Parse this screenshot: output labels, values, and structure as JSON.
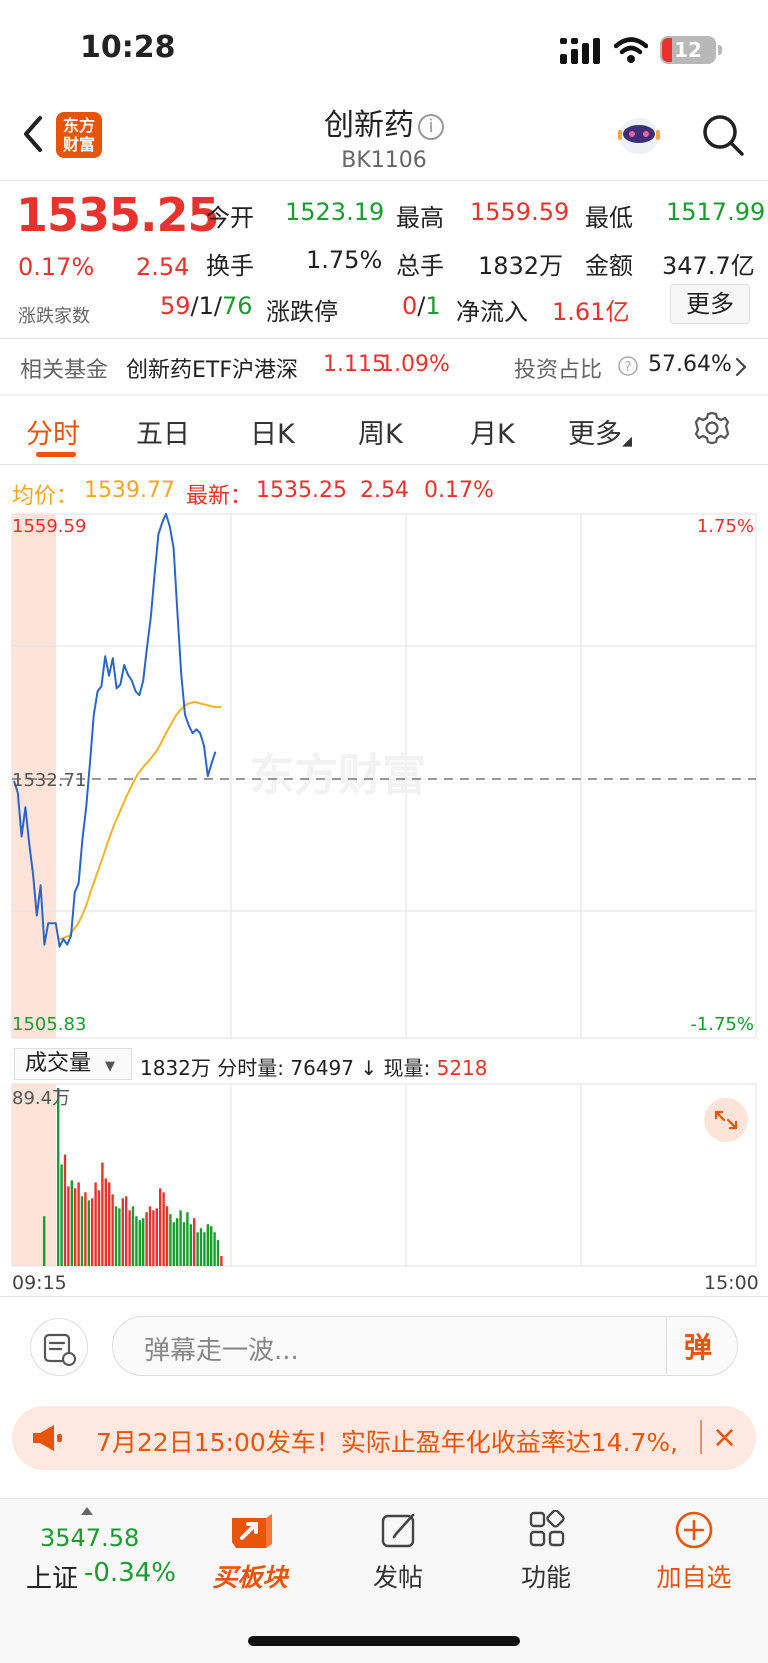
{
  "status": {
    "time": "10:28",
    "battery": "12"
  },
  "header": {
    "logo_line1": "东方",
    "logo_line2": "财富",
    "title": "创新药",
    "info": "i",
    "code": "BK1106"
  },
  "quote": {
    "price": "1535.25",
    "pct": "0.17%",
    "change": "2.54",
    "open_label": "今开",
    "open": "1523.19",
    "high_label": "最高",
    "high": "1559.59",
    "low_label": "最低",
    "low": "1517.99",
    "turnover_label": "换手",
    "turnover": "1.75%",
    "volume_label": "总手",
    "volume": "1832万",
    "amount_label": "金额",
    "amount": "347.7亿",
    "updown_label": "涨跌家数",
    "up_count": "59",
    "flat_count": "1",
    "down_count": "76",
    "slash": "/",
    "limit_label": "涨跌停",
    "limit_up": "0",
    "limit_down": "1",
    "netflow_label": "净流入",
    "netflow": "1.61亿",
    "more": "更多"
  },
  "fund": {
    "label": "相关基金",
    "name": "创新药ETF沪港深",
    "price": "1.115",
    "pct": "1.09%",
    "ratio_label": "投资占比",
    "ratio": "57.64%"
  },
  "tabs": [
    "分时",
    "五日",
    "日K",
    "周K",
    "月K",
    "更多"
  ],
  "chart": {
    "avg_label": "均价：",
    "avg": "1539.77",
    "latest_label": "最新：",
    "latest": "1535.25",
    "latest_change": "2.54",
    "latest_pct": "0.17%",
    "top_price": "1559.59",
    "mid_price": "1532.71",
    "bottom_price": "1505.83",
    "top_pct": "1.75%",
    "bottom_pct": "-1.75%",
    "watermark": "东方财富",
    "volume_select": "成交量",
    "vol_total": "1832万",
    "vol_period_label": "分时量:",
    "vol_period": "76497",
    "arrow": "↓",
    "vol_now_label": "现量:",
    "vol_now": "5218",
    "vol_max": "89.4万",
    "time_start": "09:15",
    "time_end": "15:00"
  },
  "chart_data": {
    "type": "line",
    "ylim": [
      1505.83,
      1559.59
    ],
    "baseline": 1532.71,
    "series": [
      {
        "name": "最新",
        "color": "#2a66c8",
        "values": [
          1532.2,
          1531.0,
          1526.5,
          1529.5,
          1525.8,
          1522.7,
          1518.4,
          1521.5,
          1515.4,
          1517.6,
          1517.6,
          1517.6,
          1515.2,
          1516.0,
          1515.4,
          1516.3,
          1520.8,
          1521.7,
          1526.2,
          1529.5,
          1534.1,
          1539.0,
          1541.4,
          1541.9,
          1545.0,
          1543.0,
          1544.8,
          1541.7,
          1542.1,
          1544.1,
          1543.1,
          1542.5,
          1541.4,
          1541.0,
          1542.5,
          1545.9,
          1549.0,
          1553.4,
          1557.5,
          1558.7,
          1559.6,
          1558.3,
          1556.1,
          1549.5,
          1543.2,
          1539.0,
          1537.9,
          1537.1,
          1537.5,
          1537.1,
          1535.8,
          1532.7,
          1534.0,
          1535.2
        ]
      },
      {
        "name": "均价",
        "color": "#f5b323",
        "values": [
          1516.0,
          1516.0,
          1516.2,
          1516.3,
          1516.9,
          1517.4,
          1518.1,
          1519.0,
          1520.1,
          1521.3,
          1522.4,
          1523.5,
          1524.6,
          1525.8,
          1526.9,
          1527.9,
          1528.8,
          1529.7,
          1530.6,
          1531.4,
          1532.2,
          1532.9,
          1533.4,
          1533.9,
          1534.3,
          1534.8,
          1535.3,
          1536.0,
          1536.8,
          1537.5,
          1538.2,
          1538.9,
          1539.4,
          1539.8,
          1540.1,
          1540.2,
          1540.3,
          1540.2,
          1540.1,
          1540.0,
          1539.9,
          1539.8,
          1539.8,
          1539.77
        ]
      }
    ],
    "volume": [
      80000,
      0,
      0,
      0,
      0,
      0,
      0,
      0,
      0,
      0,
      0,
      0,
      0,
      0,
      0,
      0,
      0,
      0,
      0,
      0,
      0,
      0,
      0,
      0,
      0,
      0,
      0,
      0,
      0,
      0,
      0,
      0,
      0,
      0,
      0,
      0,
      0,
      0,
      0,
      0,
      0,
      0,
      0,
      0,
      0,
      0,
      0,
      0,
      0,
      0,
      0,
      0,
      0,
      0,
      0,
      0,
      0,
      0,
      0,
      0,
      0,
      0,
      0,
      0,
      0,
      0,
      0,
      0,
      0,
      0,
      0,
      0,
      0,
      0,
      0,
      0,
      0,
      0,
      0,
      0,
      0,
      0,
      0,
      0,
      0,
      0,
      0,
      0,
      0,
      0,
      0,
      0,
      0,
      0,
      0,
      0,
      0,
      0,
      0,
      0,
      0,
      0,
      0,
      0,
      0,
      0,
      0,
      0,
      0,
      0,
      0,
      0,
      0,
      0,
      0,
      0,
      0,
      0,
      0,
      0,
      0,
      0,
      0,
      0,
      0,
      0,
      0,
      0,
      0,
      0,
      0,
      0,
      0,
      0,
      0,
      0,
      0,
      0,
      0,
      0,
      0,
      0,
      0,
      0,
      0,
      0,
      0,
      0,
      0,
      0,
      0,
      0,
      0,
      0,
      0,
      0,
      0,
      0,
      0,
      0,
      0,
      0,
      0,
      0,
      0,
      0,
      0,
      0,
      0,
      0,
      0,
      0,
      0,
      0,
      0,
      0,
      0,
      0,
      0,
      0,
      0,
      0,
      0,
      0,
      0,
      0,
      0,
      0,
      0,
      0,
      0,
      0,
      0,
      0,
      0,
      0,
      0,
      0,
      0,
      0,
      0,
      0,
      0,
      0,
      0,
      0,
      0,
      0,
      0,
      0,
      0,
      0,
      0,
      0,
      0,
      0,
      0,
      0,
      0,
      0,
      0,
      0,
      0,
      0,
      0,
      0,
      0,
      0,
      0,
      0,
      0,
      0,
      0,
      0,
      0,
      0,
      0,
      0,
      0,
      0,
      0,
      0,
      0,
      0,
      0,
      0,
      0,
      0,
      0,
      0,
      0,
      0,
      0,
      0,
      0,
      0,
      0,
      0,
      0,
      0,
      0,
      0,
      0,
      0,
      0,
      0,
      0,
      0,
      0,
      0,
      0,
      0,
      0,
      0
    ],
    "vol_bars": [
      {
        "v": 894000,
        "c": "g"
      },
      {
        "v": 510000,
        "c": "g"
      },
      {
        "v": 560000,
        "c": "r"
      },
      {
        "v": 400000,
        "c": "r"
      },
      {
        "v": 430000,
        "c": "g"
      },
      {
        "v": 390000,
        "c": "r"
      },
      {
        "v": 420000,
        "c": "r"
      },
      {
        "v": 350000,
        "c": "g"
      },
      {
        "v": 370000,
        "c": "r"
      },
      {
        "v": 330000,
        "c": "g"
      },
      {
        "v": 340000,
        "c": "r"
      },
      {
        "v": 420000,
        "c": "r"
      },
      {
        "v": 380000,
        "c": "r"
      },
      {
        "v": 520000,
        "c": "r"
      },
      {
        "v": 440000,
        "c": "r"
      },
      {
        "v": 420000,
        "c": "r"
      },
      {
        "v": 360000,
        "c": "r"
      },
      {
        "v": 300000,
        "c": "g"
      },
      {
        "v": 290000,
        "c": "g"
      },
      {
        "v": 340000,
        "c": "r"
      },
      {
        "v": 350000,
        "c": "r"
      },
      {
        "v": 280000,
        "c": "r"
      },
      {
        "v": 300000,
        "c": "g"
      },
      {
        "v": 250000,
        "c": "g"
      },
      {
        "v": 230000,
        "c": "g"
      },
      {
        "v": 240000,
        "c": "g"
      },
      {
        "v": 270000,
        "c": "r"
      },
      {
        "v": 300000,
        "c": "r"
      },
      {
        "v": 280000,
        "c": "r"
      },
      {
        "v": 290000,
        "c": "r"
      },
      {
        "v": 390000,
        "c": "r"
      },
      {
        "v": 370000,
        "c": "r"
      },
      {
        "v": 300000,
        "c": "r"
      },
      {
        "v": 260000,
        "c": "g"
      },
      {
        "v": 220000,
        "c": "g"
      },
      {
        "v": 240000,
        "c": "g"
      },
      {
        "v": 280000,
        "c": "g"
      },
      {
        "v": 220000,
        "c": "g"
      },
      {
        "v": 270000,
        "c": "g"
      },
      {
        "v": 210000,
        "c": "g"
      },
      {
        "v": 240000,
        "c": "r"
      },
      {
        "v": 170000,
        "c": "g"
      },
      {
        "v": 190000,
        "c": "g"
      },
      {
        "v": 170000,
        "c": "g"
      },
      {
        "v": 210000,
        "c": "g"
      },
      {
        "v": 200000,
        "c": "g"
      },
      {
        "v": 170000,
        "c": "g"
      },
      {
        "v": 130000,
        "c": "g"
      },
      {
        "v": 50000,
        "c": "r"
      }
    ],
    "first_bar": {
      "v": 250000,
      "c": "g"
    },
    "colors": {
      "up": "#e8322d",
      "down": "#1a9d2f",
      "price": "#2a66c8",
      "avg": "#f5b323"
    }
  },
  "bottom": {
    "barrage_placeholder": "弹幕走一波...",
    "barrage_button": "弹",
    "promo": "7月22日15:00发车！实际止盈年化收益率达14.7%,",
    "promo_close": "×",
    "index_value": "3547.58",
    "index_name": "上证",
    "index_pct": "-0.34%",
    "nav": [
      "买板块",
      "发帖",
      "功能",
      "加自选"
    ]
  }
}
